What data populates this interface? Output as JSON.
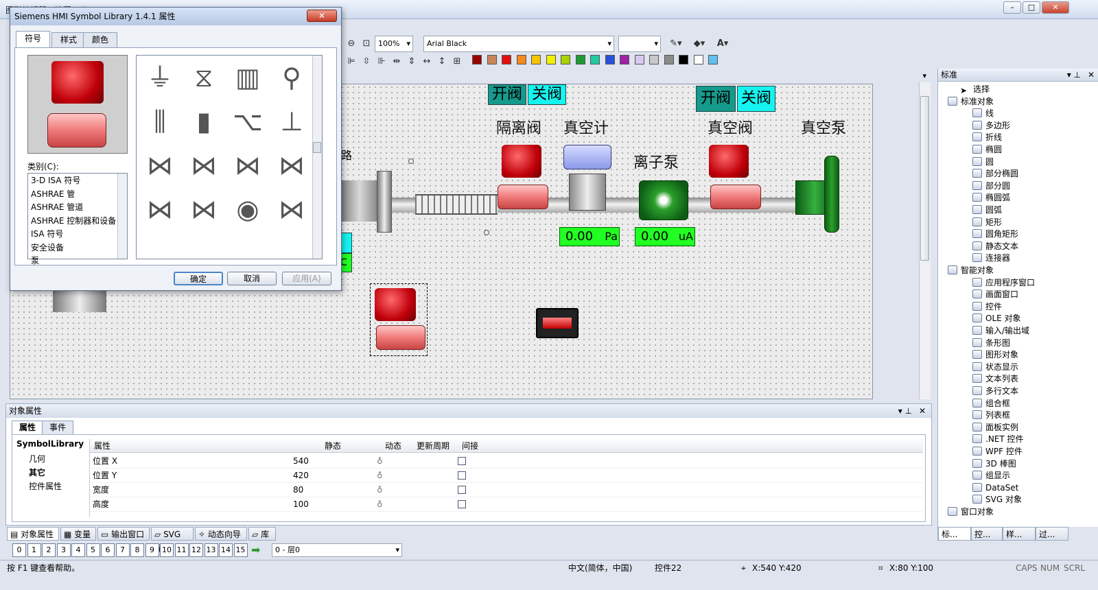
{
  "window": {
    "title": "图形编辑器 - 流程.Pdl"
  },
  "toolbar": {
    "zoom": "100%",
    "font": "Arial Black"
  },
  "palette": [
    "#9b0000",
    "#c8865a",
    "#e01010",
    "#f48a1c",
    "#f6c400",
    "#f0f000",
    "#a8d400",
    "#1c9c30",
    "#22c8a0",
    "#2850d8",
    "#a020a8",
    "#d8c8f0",
    "#c8c8c8",
    "#8c8c8c",
    "#000000",
    "#ffffff",
    "#60c0f0"
  ],
  "canvas": {
    "btn_open": "开阀",
    "btn_close": "关阀",
    "lbl_isolation": "隔离阀",
    "lbl_gauge": "真空计",
    "lbl_ion_pump": "离子泵",
    "lbl_vacuum_valve": "真空阀",
    "lbl_vacuum_pump": "真空泵",
    "disp1_value": "0.00",
    "disp1_unit": "Pa",
    "disp2_value": "0.00",
    "disp2_unit": "uA",
    "side_char": "路",
    "side_char2": "C"
  },
  "dialog": {
    "title": "Siemens HMI Symbol Library 1.4.1 属性",
    "tabs": [
      "符号",
      "样式",
      "颜色"
    ],
    "category_label": "类别(C):",
    "categories": [
      "3-D ISA 符号",
      "ASHRAE 管",
      "ASHRAE 管道",
      "ASHRAE 控制器和设备",
      "ISA 符号",
      "安全设备",
      "泵"
    ],
    "ok": "确定",
    "cancel": "取消",
    "apply": "应用(A)"
  },
  "sidepanel": {
    "title": "标准",
    "items": [
      "选择",
      "标准对象",
      "线",
      "多边形",
      "折线",
      "椭圆",
      "圆",
      "部分椭圆",
      "部分圆",
      "椭圆弧",
      "圆弧",
      "矩形",
      "圆角矩形",
      "静态文本",
      "连接器",
      "智能对象",
      "应用程序窗口",
      "画面窗口",
      "控件",
      "OLE 对象",
      "输入/输出域",
      "条形图",
      "图形对象",
      "状态显示",
      "文本列表",
      "多行文本",
      "组合框",
      "列表框",
      "面板实例",
      ".NET 控件",
      "WPF 控件",
      "3D 棒图",
      "组显示",
      "DataSet",
      "SVG 对象",
      "窗口对象"
    ],
    "bottom_tabs": [
      "标...",
      "控...",
      "样...",
      "过..."
    ]
  },
  "props": {
    "title": "对象属性",
    "tabs": [
      "属性",
      "事件"
    ],
    "tree": [
      "SymbolLibrary",
      "几何",
      "其它",
      "控件属性"
    ],
    "headers": [
      "属性",
      "静态",
      "动态",
      "更新周期",
      "间接"
    ],
    "rows": [
      {
        "name": "位置 X",
        "value": "540"
      },
      {
        "name": "位置 Y",
        "value": "420"
      },
      {
        "name": "宽度",
        "value": "80"
      },
      {
        "name": "高度",
        "value": "100"
      }
    ]
  },
  "bottom_tabs": [
    "对象属性",
    "变量",
    "输出窗口",
    "SVG 库",
    "动态向导",
    "库"
  ],
  "layers": [
    "0",
    "1",
    "2",
    "3",
    "4",
    "5",
    "6",
    "7",
    "8",
    "9",
    "10",
    "11",
    "12",
    "13",
    "14",
    "15"
  ],
  "layer_select": "0 - 层0",
  "status": {
    "help": "按 F1 键查看帮助。",
    "lang": "中文(简体，中国)",
    "obj": "控件22",
    "pos": "X:540 Y:420",
    "size": "X:80 Y:100",
    "caps": "CAPS",
    "num": "NUM",
    "scrl": "SCRL"
  }
}
